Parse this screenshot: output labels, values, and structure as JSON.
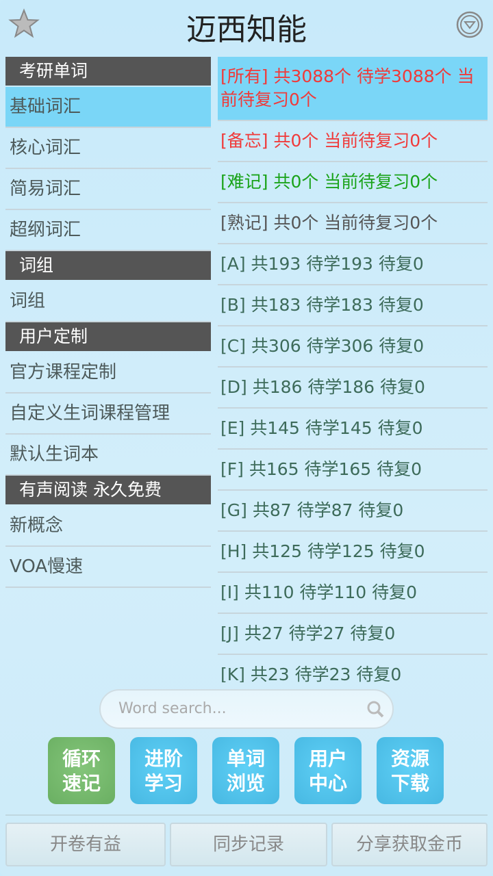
{
  "header": {
    "title": "迈西知能",
    "favorite_icon": "star-icon",
    "menu_icon": "dropdown-circle-icon"
  },
  "sidebar": {
    "sections": [
      {
        "title": "考研单词",
        "items": [
          "基础词汇",
          "核心词汇",
          "简易词汇",
          "超纲词汇"
        ]
      },
      {
        "title": "词组",
        "items": [
          "词组"
        ]
      },
      {
        "title": "用户定制",
        "items": [
          "官方课程定制",
          "自定义生词课程管理",
          "默认生词本"
        ]
      },
      {
        "title": "有声阅读 永久免费",
        "items": [
          "新概念",
          "VOA慢速"
        ]
      }
    ],
    "selected": "基础词汇"
  },
  "list": {
    "items": [
      {
        "text": "[所有] 共3088个 待学3088个 当前待复习0个",
        "color": "#f03a3a"
      },
      {
        "text": "[备忘] 共0个 当前待复习0个",
        "color": "#f03a3a"
      },
      {
        "text": "[难记] 共0个 当前待复习0个",
        "color": "#1aa31a"
      },
      {
        "text": "[熟记] 共0个 当前待复习0个",
        "color": "#555555"
      },
      {
        "text": "[A] 共193 待学193 待复0"
      },
      {
        "text": "[B] 共183 待学183 待复0"
      },
      {
        "text": "[C] 共306 待学306 待复0"
      },
      {
        "text": "[D] 共186 待学186 待复0"
      },
      {
        "text": "[E] 共145 待学145 待复0"
      },
      {
        "text": "[F] 共165 待学165 待复0"
      },
      {
        "text": "[G] 共87 待学87 待复0"
      },
      {
        "text": "[H] 共125 待学125 待复0"
      },
      {
        "text": "[I] 共110 待学110 待复0"
      },
      {
        "text": "[J] 共27 待学27 待复0"
      },
      {
        "text": "[K] 共23 待学23 待复0"
      }
    ]
  },
  "search": {
    "placeholder": "Word search...",
    "icon": "search-icon"
  },
  "tiles": [
    {
      "line1": "循环",
      "line2": "速记",
      "color": "#6aaf62"
    },
    {
      "line1": "进阶",
      "line2": "学习",
      "color": "#47b8e2"
    },
    {
      "line1": "单词",
      "line2": "浏览",
      "color": "#47b8e2"
    },
    {
      "line1": "用户",
      "line2": "中心",
      "color": "#47b8e2"
    },
    {
      "line1": "资源",
      "line2": "下载",
      "color": "#47b8e2"
    }
  ],
  "bottom_buttons": [
    "开卷有益",
    "同步记录",
    "分享获取金币"
  ]
}
